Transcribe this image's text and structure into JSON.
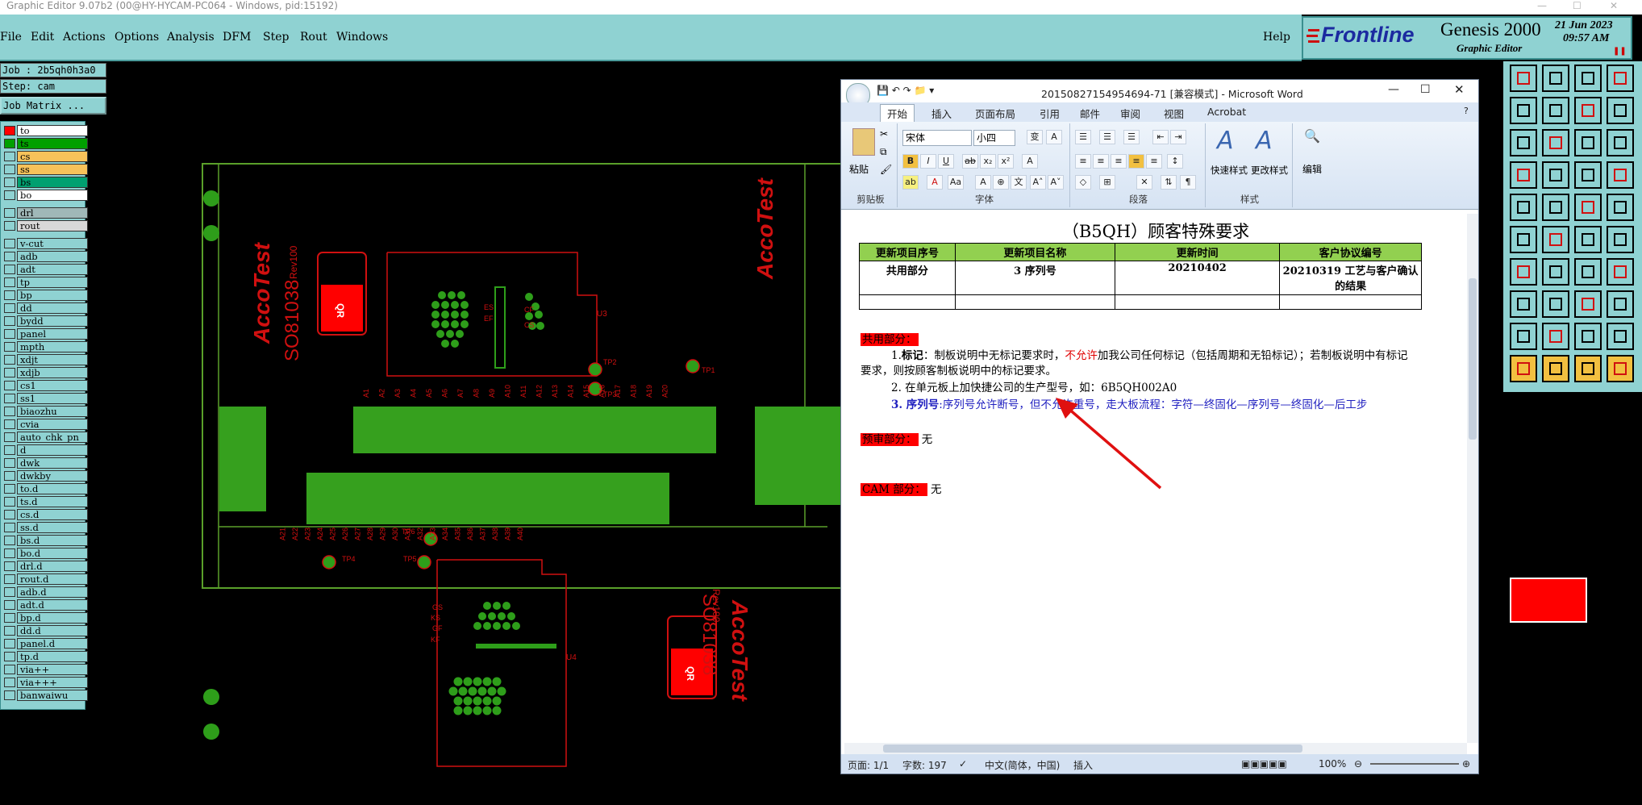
{
  "app": {
    "title": "Graphic Editor 9.07b2 (00@HY-HYCAM-PC064 - Windows, pid:15192)",
    "menus": [
      "File",
      "Edit",
      "Actions",
      "Options",
      "Analysis",
      "DFM",
      "Step",
      "Rout",
      "Windows"
    ],
    "help": "Help",
    "brand": "Frontline",
    "product": "Genesis 2000",
    "subtitle": "Graphic Editor",
    "date": "21 Jun 2023",
    "time": "09:57 AM"
  },
  "info": {
    "job": "Job : 2b5qh0h3a0",
    "step": "Step: cam",
    "matrix": "Job Matrix ..."
  },
  "layers": [
    {
      "name": "to",
      "color": "#ffffff",
      "mark": "#ff0000"
    },
    {
      "name": "ts",
      "color": "#00a000",
      "mark": "#00a000"
    },
    {
      "name": "cs",
      "color": "#f7c25a",
      "mark": "#8fd2d2"
    },
    {
      "name": "ss",
      "color": "#f7c25a",
      "mark": "#8fd2d2"
    },
    {
      "name": "bs",
      "color": "#00a070",
      "mark": "#8fd2d2"
    },
    {
      "name": "bo",
      "color": "#ffffff",
      "mark": "#8fd2d2"
    },
    {
      "name": "drl",
      "color": "#a0b8b8",
      "mark": "#8fd2d2"
    },
    {
      "name": "rout",
      "color": "#d8d8d8",
      "mark": "#8fd2d2"
    },
    {
      "name": "v-cut",
      "color": "#8fd2d2",
      "mark": "#8fd2d2"
    },
    {
      "name": "adb",
      "color": "#8fd2d2",
      "mark": "#8fd2d2"
    },
    {
      "name": "adt",
      "color": "#8fd2d2",
      "mark": "#8fd2d2"
    },
    {
      "name": "tp",
      "color": "#8fd2d2",
      "mark": "#8fd2d2"
    },
    {
      "name": "bp",
      "color": "#8fd2d2",
      "mark": "#8fd2d2"
    },
    {
      "name": "dd",
      "color": "#8fd2d2",
      "mark": "#8fd2d2"
    },
    {
      "name": "bydd",
      "color": "#8fd2d2",
      "mark": "#8fd2d2"
    },
    {
      "name": "panel",
      "color": "#8fd2d2",
      "mark": "#8fd2d2"
    },
    {
      "name": "mpth",
      "color": "#8fd2d2",
      "mark": "#8fd2d2"
    },
    {
      "name": "xdjt",
      "color": "#8fd2d2",
      "mark": "#8fd2d2"
    },
    {
      "name": "xdjb",
      "color": "#8fd2d2",
      "mark": "#8fd2d2"
    },
    {
      "name": "cs1",
      "color": "#8fd2d2",
      "mark": "#8fd2d2"
    },
    {
      "name": "ss1",
      "color": "#8fd2d2",
      "mark": "#8fd2d2"
    },
    {
      "name": "biaozhu",
      "color": "#8fd2d2",
      "mark": "#8fd2d2"
    },
    {
      "name": "cvia",
      "color": "#8fd2d2",
      "mark": "#8fd2d2"
    },
    {
      "name": "auto_chk_pn",
      "color": "#8fd2d2",
      "mark": "#8fd2d2"
    },
    {
      "name": "d",
      "color": "#8fd2d2",
      "mark": "#8fd2d2"
    },
    {
      "name": "dwk",
      "color": "#8fd2d2",
      "mark": "#8fd2d2"
    },
    {
      "name": "dwkby",
      "color": "#8fd2d2",
      "mark": "#8fd2d2"
    },
    {
      "name": "to.d",
      "color": "#8fd2d2",
      "mark": "#8fd2d2"
    },
    {
      "name": "ts.d",
      "color": "#8fd2d2",
      "mark": "#8fd2d2"
    },
    {
      "name": "cs.d",
      "color": "#8fd2d2",
      "mark": "#8fd2d2"
    },
    {
      "name": "ss.d",
      "color": "#8fd2d2",
      "mark": "#8fd2d2"
    },
    {
      "name": "bs.d",
      "color": "#8fd2d2",
      "mark": "#8fd2d2"
    },
    {
      "name": "bo.d",
      "color": "#8fd2d2",
      "mark": "#8fd2d2"
    },
    {
      "name": "drl.d",
      "color": "#8fd2d2",
      "mark": "#8fd2d2"
    },
    {
      "name": "rout.d",
      "color": "#8fd2d2",
      "mark": "#8fd2d2"
    },
    {
      "name": "adb.d",
      "color": "#8fd2d2",
      "mark": "#8fd2d2"
    },
    {
      "name": "adt.d",
      "color": "#8fd2d2",
      "mark": "#8fd2d2"
    },
    {
      "name": "bp.d",
      "color": "#8fd2d2",
      "mark": "#8fd2d2"
    },
    {
      "name": "dd.d",
      "color": "#8fd2d2",
      "mark": "#8fd2d2"
    },
    {
      "name": "panel.d",
      "color": "#8fd2d2",
      "mark": "#8fd2d2"
    },
    {
      "name": "tp.d",
      "color": "#8fd2d2",
      "mark": "#8fd2d2"
    },
    {
      "name": "via++",
      "color": "#8fd2d2",
      "mark": "#8fd2d2"
    },
    {
      "name": "via+++",
      "color": "#8fd2d2",
      "mark": "#8fd2d2"
    },
    {
      "name": "banwaiwu",
      "color": "#8fd2d2",
      "mark": "#8fd2d2"
    }
  ],
  "pcb": {
    "brand": "AccoTest",
    "part": "SO81038",
    "rev": "Rev100",
    "u3": "U3",
    "u4": "U4",
    "qr": "QR",
    "tp1": "TP1",
    "tp2": "TP2",
    "tp3": "TP3",
    "tp4": "TP4",
    "tp5": "TP5",
    "tp6": "TP6",
    "gs": "GS",
    "cs": "CS",
    "cf": "CF",
    "es": "ES",
    "ef": "EF",
    "ks": "KS",
    "kf": "KF",
    "gf": "GF",
    "topPins": [
      "A1",
      "A2",
      "A3",
      "A4",
      "A5",
      "A6",
      "A7",
      "A8",
      "A9",
      "A10",
      "A11",
      "A12",
      "A13",
      "A14",
      "A15",
      "A16",
      "A17",
      "A18",
      "A19",
      "A20"
    ],
    "bottomPins": [
      "A40",
      "A39",
      "A38",
      "A37",
      "A36",
      "A35",
      "A34",
      "A33",
      "A32",
      "A31",
      "A30",
      "A29",
      "A28",
      "A27",
      "A26",
      "A25",
      "A24",
      "A23",
      "A22",
      "A21"
    ]
  },
  "word": {
    "title": "20150827154954694-71 [兼容模式] - Microsoft Word",
    "tabs": [
      "开始",
      "插入",
      "页面布局",
      "引用",
      "邮件",
      "审阅",
      "视图",
      "Acrobat"
    ],
    "font": "宋体",
    "size": "小四",
    "groups": [
      "剪贴板",
      "字体",
      "段落",
      "样式",
      "编辑"
    ],
    "paste": "粘贴",
    "quickstyle": "快速样式",
    "changestyle": "更改样式",
    "edit": "编辑",
    "docTitle": "（B5QH）顾客特殊要求",
    "tableHeaders": [
      "更新项目序号",
      "更新项目名称",
      "更新时间",
      "客户协议编号"
    ],
    "tableRow": [
      "共用部分",
      "3 序列号",
      "20210402",
      "20210319 工艺与客户确认的结果"
    ],
    "sec1": "共用部分：",
    "line1a": "1.",
    "line1b": "标记",
    "line1c": "：制板说明中无标记要求时，",
    "line1d": "不允许",
    "line1e": "加我公司任何标记（包括周期和无铅标记）；若制板说明中有标记",
    "line1f": "要求，则按顾客制板说明中的标记要求。",
    "line2": "2. 在单元板上加快捷公司的生产型号，如：6B5QH002A0",
    "line3a": "3. 序列号",
    "line3b": ":序列号允许断号，但不允许重号，走大板流程：字符—终固化—序列号—终固化—后工步",
    "sec2": "预审部分：",
    "sec2v": "无",
    "sec3": "CAM 部分：",
    "sec3v": "无",
    "status": {
      "page": "页面: 1/1",
      "words": "字数: 197",
      "lang": "中文(简体，中国)",
      "mode": "插入",
      "zoom": "100%"
    }
  }
}
